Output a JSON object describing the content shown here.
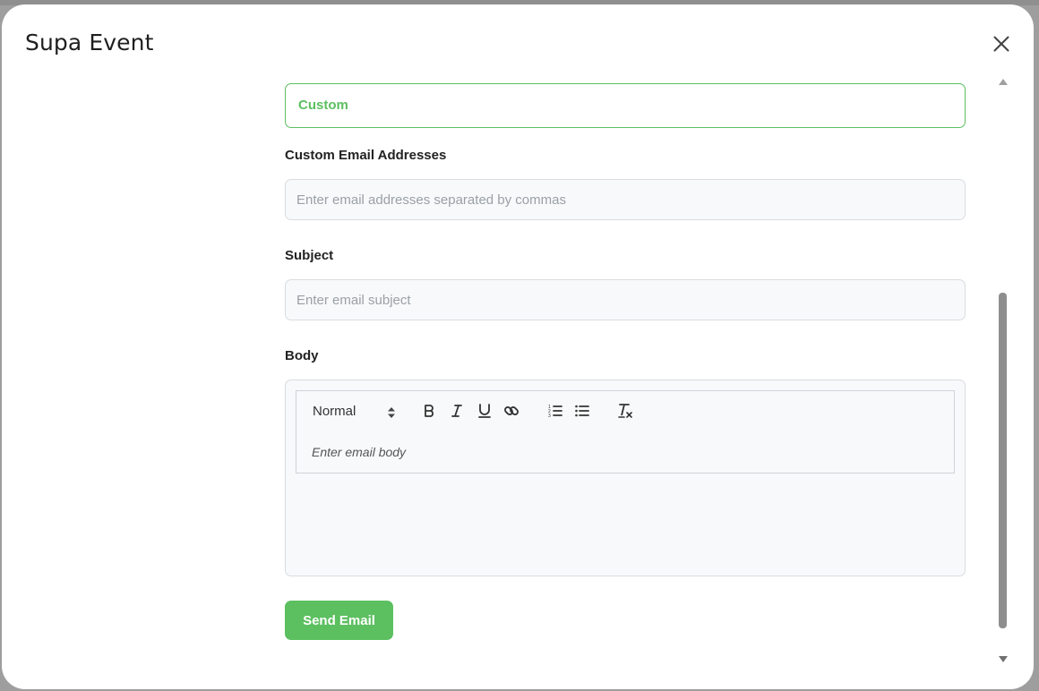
{
  "modal": {
    "title": "Supa Event"
  },
  "form": {
    "recipient_select_value": "Custom",
    "custom_emails_label": "Custom Email Addresses",
    "custom_emails_placeholder": "Enter email addresses separated by commas",
    "subject_label": "Subject",
    "subject_placeholder": "Enter email subject",
    "body_label": "Body",
    "body_placeholder": "Enter email body",
    "send_label": "Send Email"
  },
  "toolbar": {
    "format_value": "Normal",
    "buttons": [
      "bold-icon",
      "italic-icon",
      "underline-icon",
      "link-icon",
      "ordered-list-icon",
      "bullet-list-icon",
      "clear-format-icon"
    ]
  },
  "colors": {
    "accent": "#5cbf60",
    "input_bg": "#f8f9fb",
    "border": "#d9dce0"
  }
}
